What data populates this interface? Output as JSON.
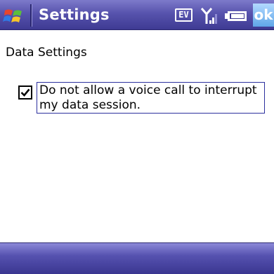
{
  "titlebar": {
    "title": "Settings",
    "ev_badge": "EV",
    "ok_label": "ok",
    "icons": [
      "windows-flag-icon",
      "ev-icon",
      "signal-icon",
      "battery-icon"
    ]
  },
  "content": {
    "section_title": "Data Settings",
    "checkbox": {
      "checked": true,
      "label": "Do not allow a voice call to interrupt my data session."
    }
  },
  "colors": {
    "titlebar": "#5753ad",
    "menubar": "#5652b0",
    "ok_button": "#5fa6e8",
    "focus_border": "#2b2f9e"
  }
}
